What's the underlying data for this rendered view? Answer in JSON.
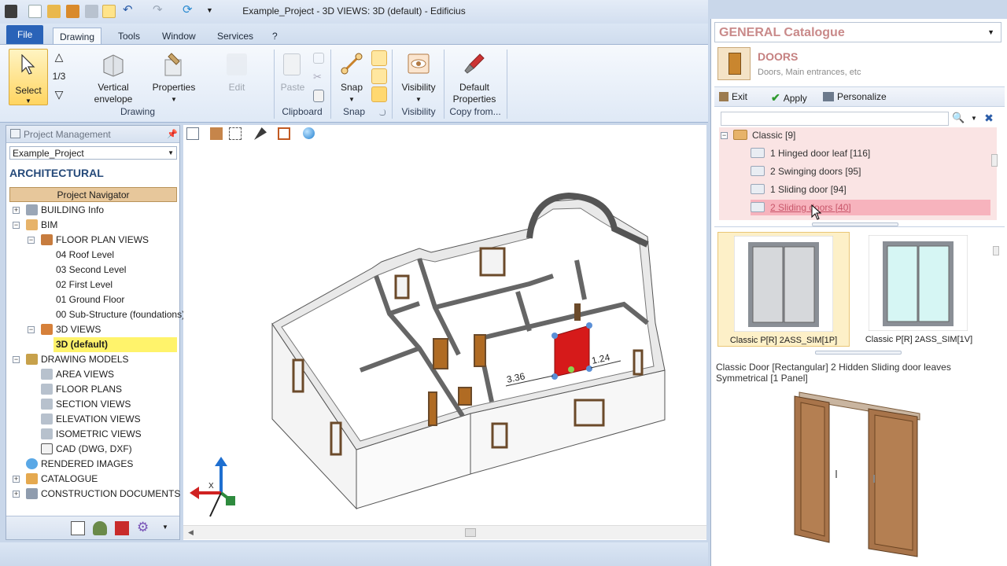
{
  "window": {
    "title": "Example_Project - 3D VIEWS: 3D (default) - Edificius"
  },
  "tabs": [
    {
      "label": "File"
    },
    {
      "label": "Drawing"
    },
    {
      "label": "Tools"
    },
    {
      "label": "Window"
    },
    {
      "label": "Services"
    },
    {
      "label": "?"
    }
  ],
  "ribbon": {
    "select_label": "Select",
    "fraction": "1/3",
    "vertical_envelope_1": "Vertical",
    "vertical_envelope_2": "envelope",
    "properties_label": "Properties",
    "edit_label": "Edit",
    "paste_label": "Paste",
    "snap_label": "Snap",
    "visibility_label": "Visibility",
    "default_props_1": "Default",
    "default_props_2": "Properties",
    "groups": {
      "drawing": "Drawing",
      "clipboard": "Clipboard",
      "snap": "Snap",
      "visibility": "Visibility",
      "copy_from": "Copy from..."
    }
  },
  "project_management": {
    "title": "Project Management",
    "project_select": "Example_Project",
    "section": "ARCHITECTURAL",
    "navigator": "Project Navigator",
    "tree": [
      {
        "label": "BUILDING Info"
      },
      {
        "label": "BIM"
      },
      {
        "label": "FLOOR PLAN VIEWS"
      },
      {
        "label": "04 Roof Level"
      },
      {
        "label": "03 Second Level"
      },
      {
        "label": "02 First Level"
      },
      {
        "label": "01 Ground Floor"
      },
      {
        "label": "00 Sub-Structure (foundations)"
      },
      {
        "label": "3D VIEWS"
      },
      {
        "label": "3D (default)"
      },
      {
        "label": "DRAWING MODELS"
      },
      {
        "label": "AREA VIEWS"
      },
      {
        "label": "FLOOR PLANS"
      },
      {
        "label": "SECTION VIEWS"
      },
      {
        "label": "ELEVATION VIEWS"
      },
      {
        "label": "ISOMETRIC VIEWS"
      },
      {
        "label": "CAD (DWG, DXF)"
      },
      {
        "label": "RENDERED IMAGES"
      },
      {
        "label": "CATALOGUE"
      },
      {
        "label": "CONSTRUCTION DOCUMENTS SET"
      }
    ]
  },
  "view3d": {
    "dim_left": "3.36",
    "dim_right": "1.24",
    "axis_x": "X"
  },
  "catalogue": {
    "title": "GENERAL Catalogue",
    "category_title": "DOORS",
    "category_sub": "Doors, Main entrances, etc",
    "exit_label": "Exit",
    "apply_label": "Apply",
    "personalize_label": "Personalize",
    "tree": [
      {
        "label": "Classic   [9]"
      },
      {
        "label": "1 Hinged door leaf   [116]"
      },
      {
        "label": "2 Swinging doors   [95]"
      },
      {
        "label": "1 Sliding door   [94]"
      },
      {
        "label": "2 Sliding doors   [40]"
      }
    ],
    "thumbs": [
      {
        "label": "Classic P[R] 2ASS_SIM[1P]"
      },
      {
        "label": "Classic P[R] 2ASS_SIM[1V]"
      }
    ],
    "description": "Classic Door [Rectangular] 2 Hidden Sliding door leaves Symmetrical [1 Panel]"
  },
  "colors": {
    "accent": "#2a63b8",
    "selection_yellow": "#fff36b",
    "catalogue_title": "#c98a8a",
    "highlight_pink": "#f7b3bd",
    "door_red": "#d61a1a"
  }
}
